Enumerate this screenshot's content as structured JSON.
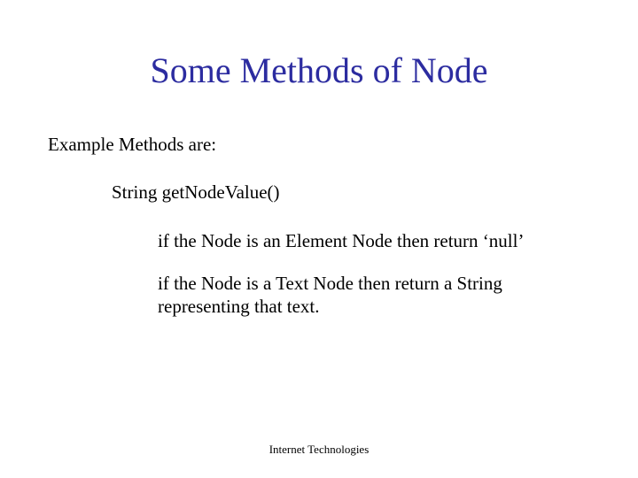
{
  "title": "Some Methods of Node",
  "body": {
    "intro": "Example Methods are:",
    "method": "String getNodeValue()",
    "desc1": "if the Node is an Element Node then return ‘null’",
    "desc2": "if the Node is a Text Node then return a String representing that text."
  },
  "footer": "Internet Technologies"
}
